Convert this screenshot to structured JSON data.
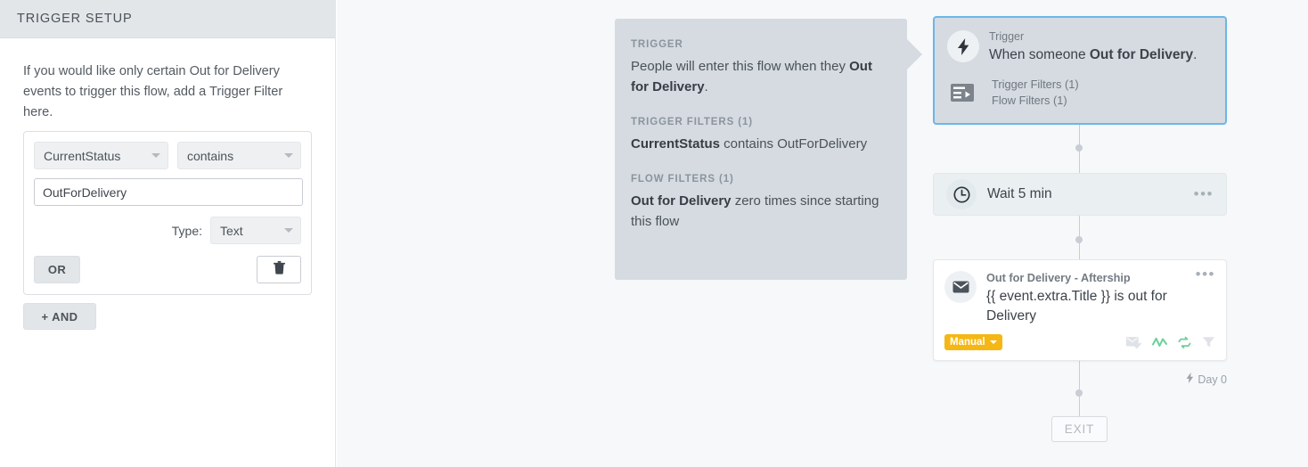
{
  "panel": {
    "header_title": "TRIGGER SETUP",
    "description": "If you would like only certain Out for Delivery events to trigger this flow, add a Trigger Filter here.",
    "filter": {
      "field_value": "CurrentStatus",
      "operator_value": "contains",
      "value_input": "OutForDelivery",
      "value_placeholder": "",
      "type_label": "Type:",
      "type_value": "Text",
      "or_label": "OR",
      "delete_icon": "trash-icon"
    },
    "and_label": "+ AND"
  },
  "tooltip": {
    "sections": [
      {
        "heading": "TRIGGER",
        "text_before": "People will enter this flow when they ",
        "text_bold": "Out for Delivery",
        "text_after": "."
      },
      {
        "heading": "TRIGGER FILTERS (1)",
        "text_before": "",
        "text_bold": "CurrentStatus",
        "text_after": " contains OutForDelivery"
      },
      {
        "heading": "FLOW FILTERS (1)",
        "text_before": "",
        "text_bold": "Out for Delivery",
        "text_after": " zero times since starting this flow"
      }
    ]
  },
  "flow": {
    "trigger_card": {
      "icon": "lightning-bolt-icon",
      "label": "Trigger",
      "title_before": "When someone ",
      "title_bold": "Out for Delivery",
      "title_after": ".",
      "filters_icon": "filters-list-icon",
      "trigger_filters": "Trigger Filters (1)",
      "flow_filters": "Flow Filters (1)"
    },
    "wait_card": {
      "icon": "clock-icon",
      "label": "Wait 5 min",
      "menu": "•••"
    },
    "email_card": {
      "icon": "envelope-icon",
      "name": "Out for Delivery - Aftership",
      "subject": "{{ event.extra.Title }} is out for Delivery",
      "menu": "•••",
      "badge_label": "Manual",
      "status_icons": [
        "envelope-check-icon",
        "smart-sending-icon",
        "utm-tracking-icon",
        "filter-funnel-icon"
      ]
    },
    "day_label": "Day 0",
    "day_icon": "lightning-bolt-icon",
    "exit_label": "EXIT"
  },
  "colors": {
    "accent_blue": "#6cb6e8",
    "badge_amber": "#f5b714",
    "icon_green": "#6ecf9a",
    "tooltip_bg": "#d5dbe1",
    "canvas_bg": "#f6f8fa"
  }
}
